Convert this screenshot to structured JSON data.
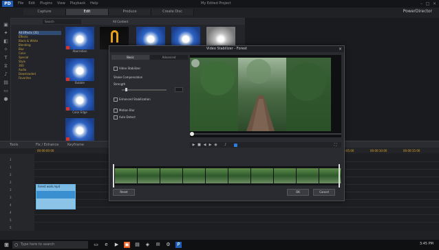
{
  "app": {
    "logo": "PD",
    "menu": [
      "File",
      "Edit",
      "Plugins",
      "View",
      "Playback",
      "Help"
    ],
    "title": "My Edited Project",
    "brand": "PowerDirector",
    "window_controls": [
      "–",
      "□",
      "×"
    ]
  },
  "tabs": [
    {
      "label": "Capture",
      "active": false
    },
    {
      "label": "Edit",
      "active": true
    },
    {
      "label": "Produce",
      "active": false
    },
    {
      "label": "Create Disc",
      "active": false
    }
  ],
  "sidebar_icons": [
    "media-icon",
    "fx-icon",
    "pip-icon",
    "particle-icon",
    "title-icon",
    "transition-icon",
    "audio-icon",
    "chapter-icon",
    "subtitle-icon",
    "voice-icon"
  ],
  "library": {
    "filter_placeholder": "Search",
    "view_all": "All Content",
    "tree": [
      {
        "label": "All Effects (31)",
        "selected": true
      },
      {
        "label": "Effects",
        "selected": false
      },
      {
        "label": "Black & White",
        "selected": false
      },
      {
        "label": "Blending",
        "selected": false
      },
      {
        "label": "Blur",
        "selected": false
      },
      {
        "label": "Color",
        "selected": false
      },
      {
        "label": "Special",
        "selected": false
      },
      {
        "label": "Style",
        "selected": false
      },
      {
        "label": "360",
        "selected": false
      },
      {
        "label": "Audio",
        "selected": false
      },
      {
        "label": "Downloaded",
        "selected": false
      },
      {
        "label": "Favorites",
        "selected": false
      }
    ],
    "thumbs": [
      {
        "label": "Aberration",
        "style": "blue"
      },
      {
        "label": "Abstract",
        "style": "arch"
      },
      {
        "label": "Block Art",
        "style": "blue"
      },
      {
        "label": "Bloom",
        "style": "blue"
      },
      {
        "label": "Bokeh",
        "style": "grey"
      },
      {
        "label": "Bubble",
        "style": "blue"
      },
      {
        "label": "Color Edge",
        "style": "blue"
      },
      {
        "label": "Crayon",
        "style": "blue"
      }
    ]
  },
  "timeline": {
    "tools": [
      "Tools",
      "Fix / Enhance",
      "Keyframe"
    ],
    "ruler_ticks": [
      "00:00:00:00",
      "00:00:05:00",
      "00:00:10:00",
      "00:00:15:00",
      "00:00:20:00"
    ],
    "tracks": [
      "1",
      "1",
      "2",
      "2",
      "3",
      "3",
      "4",
      "4",
      "5",
      "5"
    ],
    "clip_label": "forest walk.mp4"
  },
  "dialog": {
    "title": "Video Stabilizer - Forest",
    "close": "×",
    "tabs": [
      {
        "label": "Basic",
        "active": true
      },
      {
        "label": "Advanced",
        "active": false
      }
    ],
    "options": [
      "Video Stabilizer",
      "Shake Compensation",
      "Enhanced Stabilization",
      "Motion Blur",
      "Auto Detect"
    ],
    "strength_label": "Strength",
    "buttons": {
      "reset": "Reset",
      "ok": "OK",
      "cancel": "Cancel"
    }
  },
  "taskbar": {
    "search_placeholder": "Type here to search",
    "time": "3:45 PM",
    "date": "10/12/2017"
  },
  "colors": {
    "accent": "#1d5db8",
    "timeline_tick": "#e3a625",
    "clip": "#3a8fd0"
  }
}
